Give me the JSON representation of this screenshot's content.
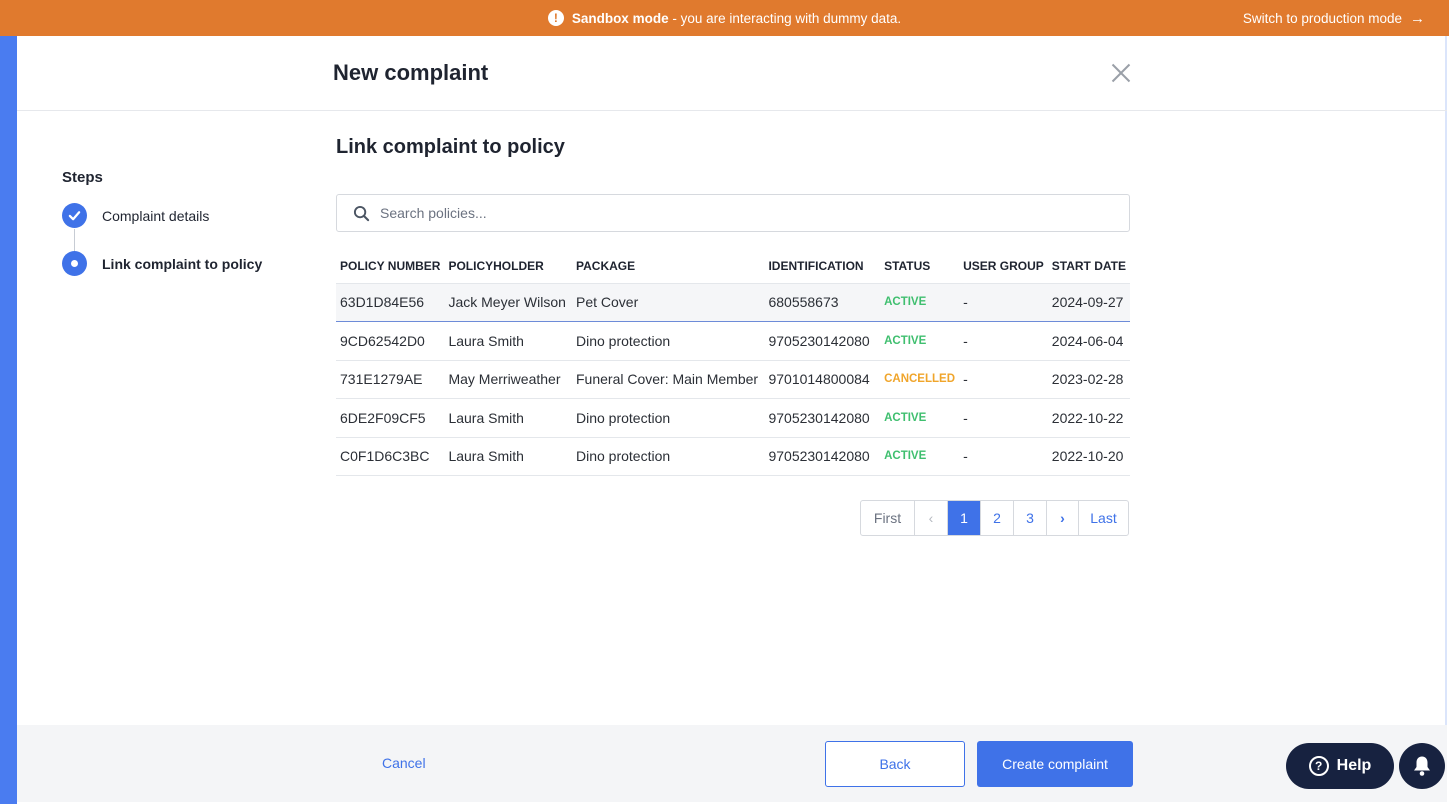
{
  "banner": {
    "mode_label": "Sandbox mode",
    "message": " - you are interacting with dummy data.",
    "switch_label": "Switch to production mode"
  },
  "modal": {
    "title": "New complaint"
  },
  "steps": {
    "title": "Steps",
    "items": [
      {
        "label": "Complaint details",
        "state": "completed"
      },
      {
        "label": "Link complaint to policy",
        "state": "current"
      }
    ]
  },
  "main": {
    "section_title": "Link complaint to policy",
    "search_placeholder": "Search policies...",
    "search_value": ""
  },
  "table": {
    "headers": [
      "POLICY NUMBER",
      "POLICYHOLDER",
      "PACKAGE",
      "IDENTIFICATION",
      "STATUS",
      "USER GROUP",
      "START DATE"
    ],
    "rows": [
      {
        "policy_number": "63D1D84E56",
        "policyholder": "Jack Meyer Wilson",
        "package": "Pet Cover",
        "identification": "680558673",
        "status": "ACTIVE",
        "user_group": "-",
        "start_date": "2024-09-27"
      },
      {
        "policy_number": "9CD62542D0",
        "policyholder": "Laura Smith",
        "package": "Dino protection",
        "identification": "9705230142080",
        "status": "ACTIVE",
        "user_group": "-",
        "start_date": "2024-06-04"
      },
      {
        "policy_number": "731E1279AE",
        "policyholder": "May Merriweather",
        "package": "Funeral Cover: Main Member",
        "identification": "9701014800084",
        "status": "CANCELLED",
        "user_group": "-",
        "start_date": "2023-02-28"
      },
      {
        "policy_number": "6DE2F09CF5",
        "policyholder": "Laura Smith",
        "package": "Dino protection",
        "identification": "9705230142080",
        "status": "ACTIVE",
        "user_group": "-",
        "start_date": "2022-10-22"
      },
      {
        "policy_number": "C0F1D6C3BC",
        "policyholder": "Laura Smith",
        "package": "Dino protection",
        "identification": "9705230142080",
        "status": "ACTIVE",
        "user_group": "-",
        "start_date": "2022-10-20"
      }
    ]
  },
  "pagination": {
    "first": "First",
    "prev": "‹",
    "pages": [
      "1",
      "2",
      "3"
    ],
    "current": "1",
    "next": "›",
    "last": "Last"
  },
  "footer": {
    "cancel": "Cancel",
    "back": "Back",
    "create": "Create complaint"
  },
  "widgets": {
    "help_label": "Help"
  },
  "colors": {
    "banner": "#e07a2e",
    "primary": "#3f72e8",
    "active_status": "#3fbf6f",
    "cancelled_status": "#f0a52b",
    "help_bg": "#172240"
  }
}
